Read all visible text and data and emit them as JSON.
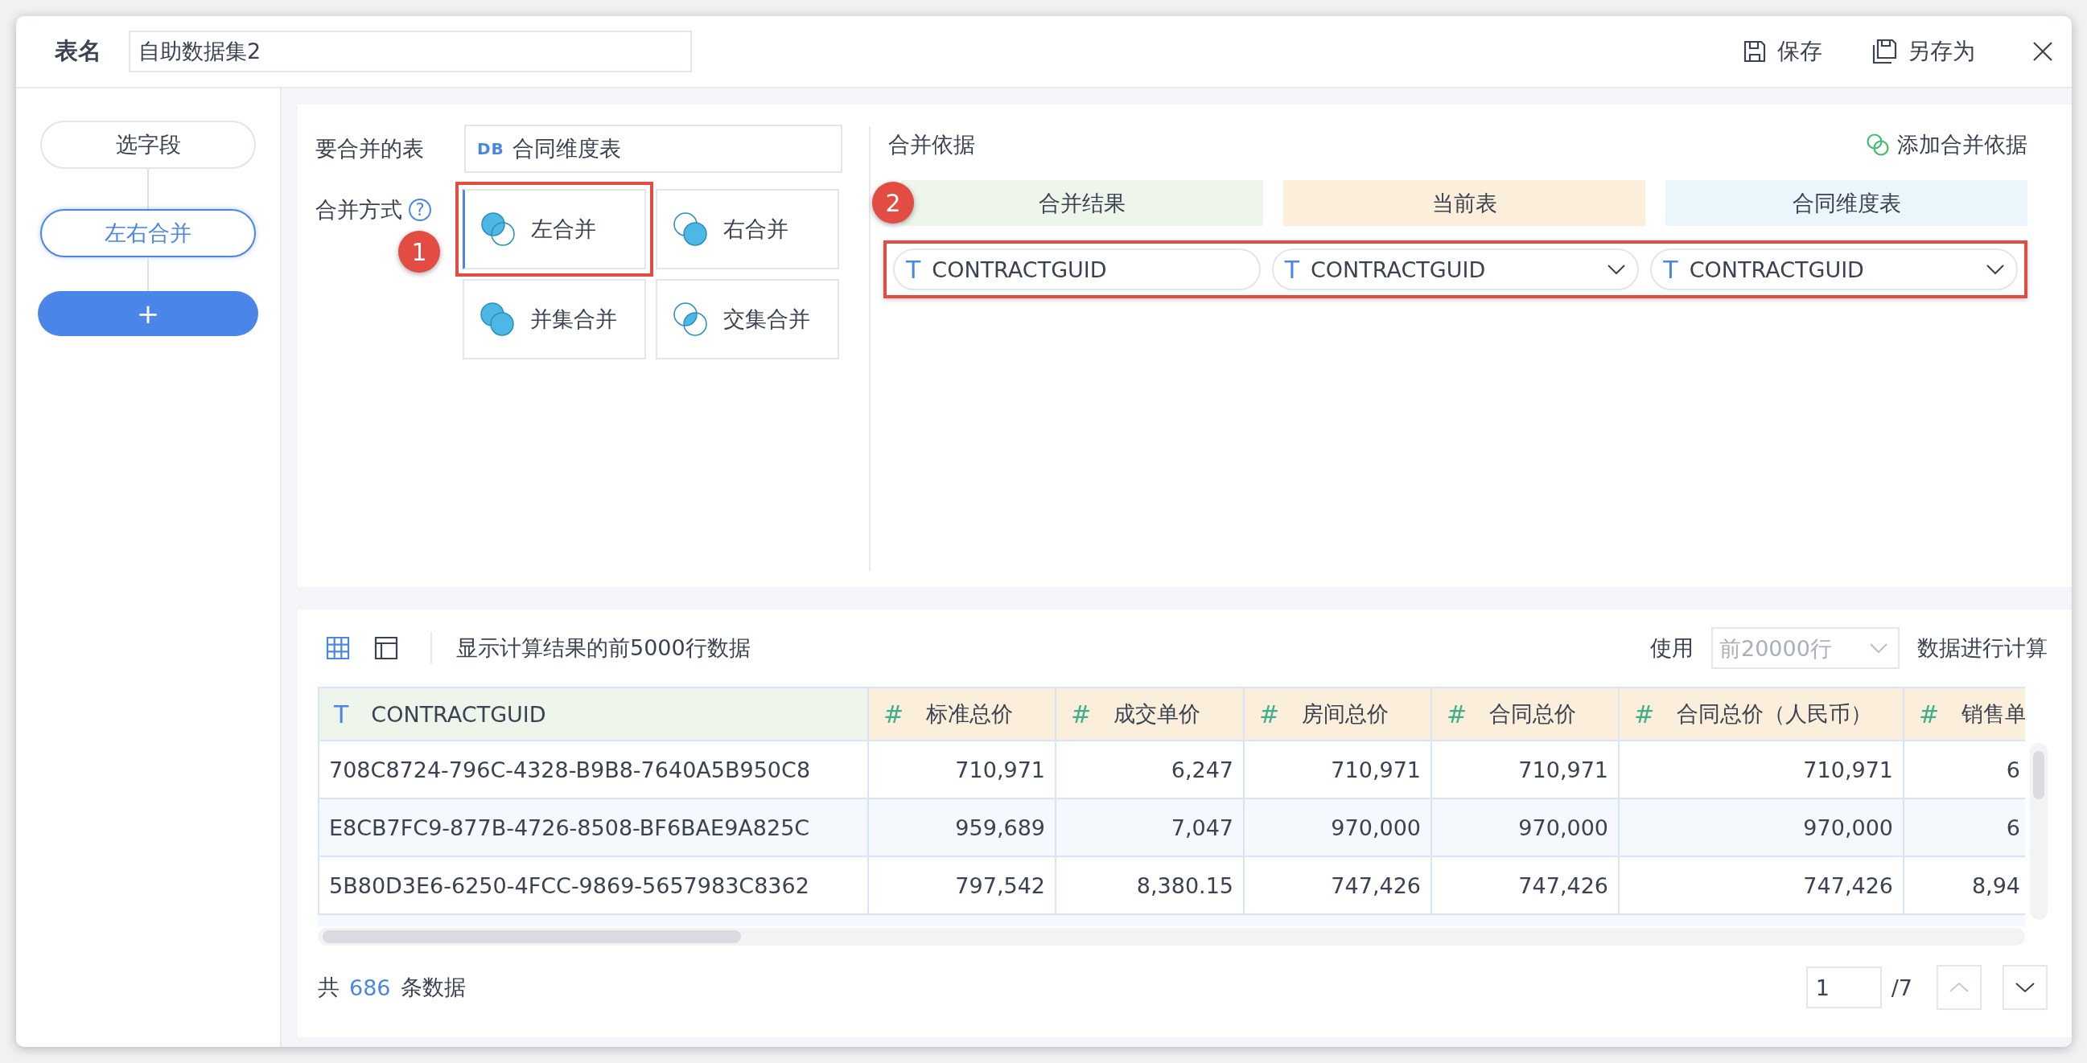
{
  "header": {
    "name_label": "表名",
    "name_value": "自助数据集2",
    "actions": [
      {
        "kind": "save",
        "label": "保存"
      },
      {
        "kind": "save_as",
        "label": "另存为"
      }
    ]
  },
  "sidebar": {
    "steps": [
      {
        "label": "选字段",
        "selected": false
      },
      {
        "label": "左右合并",
        "selected": true
      }
    ],
    "add_button": "+"
  },
  "merge_table": {
    "label": "要合并的表",
    "badge": "DB",
    "value": "合同维度表"
  },
  "merge_method": {
    "label": "合并方式",
    "help": "?",
    "callout": "1",
    "options": [
      {
        "kind": "left",
        "label": "左合并",
        "selected": true,
        "highlighted": true
      },
      {
        "kind": "right",
        "label": "右合并",
        "selected": false,
        "highlighted": false
      },
      {
        "kind": "union",
        "label": "并集合并",
        "selected": false,
        "highlighted": false
      },
      {
        "kind": "intersection",
        "label": "交集合并",
        "selected": false,
        "highlighted": false
      }
    ]
  },
  "merge_basis": {
    "title": "合并依据",
    "add_label": "添加合并依据",
    "callout": "2",
    "columns": [
      {
        "label": "合并结果",
        "color": "#eef6ec",
        "field": {
          "type_icon": "T",
          "value": "CONTRACTGUID",
          "kind": "fixed"
        }
      },
      {
        "label": "当前表",
        "color": "#fbeedb",
        "field": {
          "type_icon": "T",
          "value": "CONTRACTGUID",
          "kind": "dropdown"
        }
      },
      {
        "label": "合同维度表",
        "color": "#eaf5fc",
        "field": {
          "type_icon": "T",
          "value": "CONTRACTGUID",
          "kind": "dropdown"
        }
      }
    ]
  },
  "preview": {
    "view_toggles": [
      {
        "kind": "grid",
        "selected": true
      },
      {
        "kind": "panel",
        "selected": false
      }
    ],
    "info": "显示计算结果的前5000行数据",
    "use_label": "使用",
    "row_limit": {
      "placeholder": "前20000行"
    },
    "use_suffix": "数据进行计算"
  },
  "table": {
    "columns": [
      {
        "kind": "text",
        "type_icon": "T",
        "label": "CONTRACTGUID"
      },
      {
        "kind": "number",
        "type_icon": "#",
        "label": "标准总价"
      },
      {
        "kind": "number",
        "type_icon": "#",
        "label": "成交单价"
      },
      {
        "kind": "number",
        "type_icon": "#",
        "label": "房间总价"
      },
      {
        "kind": "number",
        "type_icon": "#",
        "label": "合同总价"
      },
      {
        "kind": "number",
        "type_icon": "#",
        "label": "合同总价（人民币）"
      },
      {
        "kind": "number",
        "type_icon": "#",
        "label": "销售单"
      }
    ],
    "rows": [
      [
        "708C8724-796C-4328-B9B8-7640A5B950C8",
        "710,971",
        "6,247",
        "710,971",
        "710,971",
        "710,971",
        "6"
      ],
      [
        "E8CB7FC9-877B-4726-8508-BF6BAE9A825C",
        "959,689",
        "7,047",
        "970,000",
        "970,000",
        "970,000",
        "6"
      ],
      [
        "5B80D3E6-6250-4FCC-9869-5657983C8362",
        "797,542",
        "8,380.15",
        "747,426",
        "747,426",
        "747,426",
        "8,94"
      ]
    ]
  },
  "footer": {
    "prefix": "共",
    "count": "686",
    "suffix": "条数据",
    "page": "1",
    "page_total": "/7",
    "prev_disabled": true,
    "next_disabled": false
  }
}
